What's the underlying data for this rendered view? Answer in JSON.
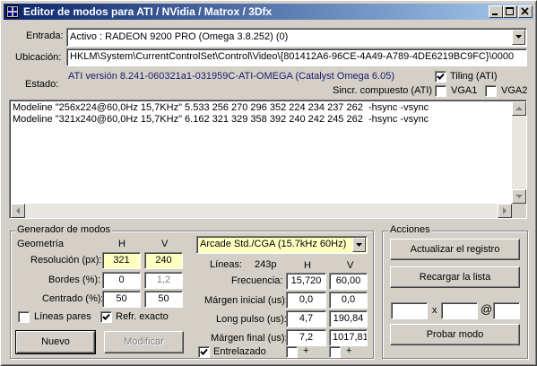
{
  "window": {
    "title": "Editor de modos para ATI / NVidia / Matrox / 3Dfx"
  },
  "entrada": {
    "label": "Entrada:",
    "value": "Activo : RADEON 9200 PRO (Omega 3.8.252) (0)"
  },
  "ubicacion": {
    "label": "Ubicación:",
    "value": "HKLM\\System\\CurrentControlSet\\Control\\Video\\{801412A6-96CE-4A49-A789-4DE6219BC9FC}\\0000"
  },
  "estado": {
    "label": "Estado:",
    "value": "ATI versión 8.241-060321a1-031959C-ATI-OMEGA (Catalyst Omega 6.05)"
  },
  "tiling": {
    "label": "Tiling (ATI)",
    "checked": true
  },
  "sincr": {
    "label": "Sincr. compuesto (ATI)"
  },
  "vga1": {
    "label": "VGA1",
    "checked": false
  },
  "vga2": {
    "label": "VGA2",
    "checked": false
  },
  "modelines": [
    "Modeline \"256x224@60,0Hz 15,7KHz\" 5.533 256 270 296 352 224 234 237 262  -hsync -vsync",
    "Modeline \"321x240@60,0Hz 15,7KHz\" 6.162 321 329 358 392 240 242 245 262  -hsync -vsync"
  ],
  "generator": {
    "title": "Generador de modos",
    "geometria": "Geometría",
    "col_h": "H",
    "col_v": "V",
    "resolucion_label": "Resolución (px):",
    "resolucion_h": "321",
    "resolucion_v": "240",
    "bordes_label": "Bordes (%):",
    "bordes_h": "0",
    "bordes_v": "1,2",
    "centrado_label": "Centrado (%):",
    "centrado_h": "50",
    "centrado_v": "50",
    "lineas_pares_label": "Líneas pares",
    "lineas_pares_checked": false,
    "refr_exacto_label": "Refr. exacto",
    "refr_exacto_checked": true,
    "nuevo_label": "Nuevo",
    "modificar_label": "Modificar",
    "preset": "Arcade Std./CGA (15.7kHz 60Hz)",
    "lineas_label": "Líneas:",
    "lineas_value": "243p",
    "col2_h": "H",
    "col2_v": "V",
    "frecuencia_label": "Frecuencia:",
    "frecuencia_h": "15,720",
    "frecuencia_v": "60,00",
    "margen_inicial_label": "Márgen inicial (us):",
    "margen_inicial_h": "0,0",
    "margen_inicial_v": "0,0",
    "long_pulso_label": "Long pulso (us):",
    "long_pulso_h": "4,7",
    "long_pulso_v": "190,84",
    "margen_final_label": "Márgen final (us):",
    "margen_final_h": "7,2",
    "margen_final_v": "1017,81",
    "entrelazado_label": "Entrelazado",
    "entrelazado_checked": true,
    "plus1": "+",
    "plus2": "+"
  },
  "acciones": {
    "title": "Acciones",
    "actualizar_label": "Actualizar el registro",
    "recargar_label": "Recargar la lista",
    "x_sep": "x",
    "at_sep": "@",
    "probar_label": "Probar modo"
  }
}
